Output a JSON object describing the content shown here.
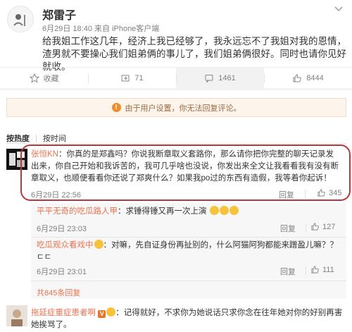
{
  "post": {
    "author": "郑雷子",
    "meta": "6月29日 18:40 来自 iPhone客户端",
    "text": "给我姐工作这几年，经济上我已经够了，我永远忘不了我姐对我的恩情，渣男就不要操心我们姐弟俩的事儿了，我们姐弟俩很好。同时也请你见好就收。",
    "actions": [
      {
        "label": "收藏",
        "icon": "star-icon"
      },
      {
        "label": "71",
        "icon": "repost-icon"
      },
      {
        "label": "1461",
        "icon": "comment-icon"
      },
      {
        "label": "8444",
        "icon": "like-icon"
      }
    ]
  },
  "notice": {
    "text": "由于用户设置，你无法回复评论。",
    "icon": "warning-icon"
  },
  "sort": {
    "hot": "按热度",
    "time": "按时间"
  },
  "comments": [
    {
      "user": "张恒KN",
      "text": "：你真的是郑鑫吗？你说我断章取义套路你，那么请你把你完整的聊天记录发出来，你自己开始和我诉苦的，我可几乎啥也没说，你发出来全文让我看看我有没有断章取义，也顺便看看你还说了郑爽什么？如果我po过的东西有造假，我等着你起诉！",
      "time": "6月29日 22:56",
      "reply": "回复",
      "likes": "345"
    },
    {
      "user": "平平无奇的吃瓜路人甲",
      "text": "：求锤得锤又再一次上演",
      "time": "6月29日 23:03",
      "reply": "回复",
      "likes": "127"
    },
    {
      "user": "吃瓜观众看戏中",
      "text": "：对嘛，先自证身份再扯别的，什么阿猫阿狗都能来蹭盈儿嘛？？ㄷㄷ",
      "time": "6月29日 23:01",
      "reply": "回复",
      "likes": "111"
    },
    {
      "user": "拖延症重症患者啊",
      "text": "：记得就好，不求你为她说话只求你念在往年她对你的好别再害她挨骂了。"
    }
  ],
  "more_replies": "共845条回复",
  "colors": {
    "accent": "#eb7350",
    "highlight_border": "#b8373b",
    "notice_bg": "#fdf4ec"
  }
}
